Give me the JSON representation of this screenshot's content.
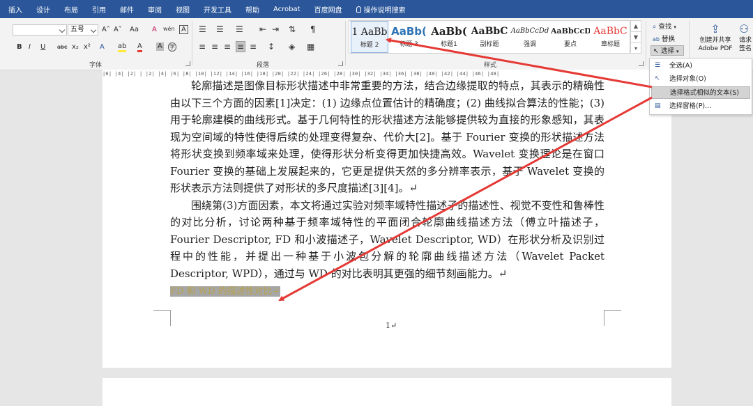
{
  "tabs": [
    "插入",
    "设计",
    "布局",
    "引用",
    "邮件",
    "审阅",
    "视图",
    "开发工具",
    "帮助",
    "Acrobat",
    "百度网盘"
  ],
  "tell_me": "操作说明搜索",
  "font": {
    "name_value": "",
    "size_value": "五号",
    "group_label": "字体",
    "grow": "A˄",
    "shrink": "A˅",
    "case": "Aa",
    "clear": "A",
    "phonetic": "wén",
    "charborder": "A",
    "bold": "B",
    "italic": "I",
    "underline": "U",
    "strike": "abc",
    "sub": "x₂",
    "sup": "x²",
    "effects": "A",
    "highlight": "ab",
    "color": "A",
    "shade": "A",
    "enclose": "字"
  },
  "paragraph": {
    "group_label": "段落"
  },
  "styles": {
    "group_label": "样式",
    "items": [
      {
        "preview": "1  AaBb",
        "name": "标题 2"
      },
      {
        "preview": "AaBb(",
        "name": "标题 3"
      },
      {
        "preview": "AaBb(",
        "name": "标题1"
      },
      {
        "preview": "AaBbC",
        "name": "副标题"
      },
      {
        "preview": "AaBbCcDd",
        "name": "强调"
      },
      {
        "preview": "AaBbCcD",
        "name": "要点"
      },
      {
        "preview": "AaBbC",
        "name": "章标题"
      }
    ]
  },
  "editing": {
    "find": "查找",
    "replace": "替换",
    "select": "选择"
  },
  "adobe": {
    "label_1": "创建并共享",
    "label_2": "Adobe PDF"
  },
  "sign": {
    "label_1": "请求",
    "label_2": "签名"
  },
  "ruler_text": "|6| |4| |2| | |2| |4| |6| |8| |10| |12| |14| |16| |18| |20| |22| |24| |26| |28| |30| |32| |34| |36| |38| |40| |42| |44| |46| |48|",
  "select_menu": [
    {
      "label": "全选(A)",
      "icon": "☰"
    },
    {
      "label": "选择对象(O)",
      "icon": "↖"
    },
    {
      "label": "选择格式相似的文本(S)",
      "icon": ""
    },
    {
      "label": "选择窗格(P)...",
      "icon": "▤"
    }
  ],
  "document": {
    "p1": "轮廓描述是图像目标形状描述中非常重要的方法，结合边缘提取的特点，其表示的精确性由以下三个方面的因素[1]决定：(1) 边缘点位置估计的精确度；(2) 曲线拟合算法的性能；(3) 用于轮廓建模的曲线形式。基于几何特性的形状描述方法能够提供较为直接的形象感知，其表现为空间域的特性使得后续的处理变得复杂、代价大[2]。基于 Fourier 变换的形状描述方法将形状变换到频率域来处理，使得形状分析变得更加快捷高效。Wavelet 变换理论是在窗口 Fourier 变换的基础上发展起来的，它更是提供天然的多分辨率表示，基于 Wavelet 变换的形状表示方法则提供了对形状的多尺度描述[3][4]。↵",
    "p2": "围绕第(3)方面因素，本文将通过实验对频率域特性描述子的描述性、视觉不变性和鲁棒性的对比分析，讨论两种基于频率域特性的平面闭合轮廓曲线描述方法（傅立叶描述子，Fourier Descriptor, FD 和小波描述子，Wavelet Descriptor, WD）在形状分析及识别过程中的性能，并提出一种基于小波包分解的轮廓曲线描述方法（Wavelet Packet Descriptor, WPD），通过与 WD 的对比表明其更强的细节刻画能力。↵",
    "highlighted": "FD 和 WD 的描述性对比↵",
    "page_number": "1↵"
  },
  "colors": {
    "tabbar": "#2b579a",
    "annotation_red": "#e53935",
    "highlight_bg": "#a6a6a6"
  }
}
